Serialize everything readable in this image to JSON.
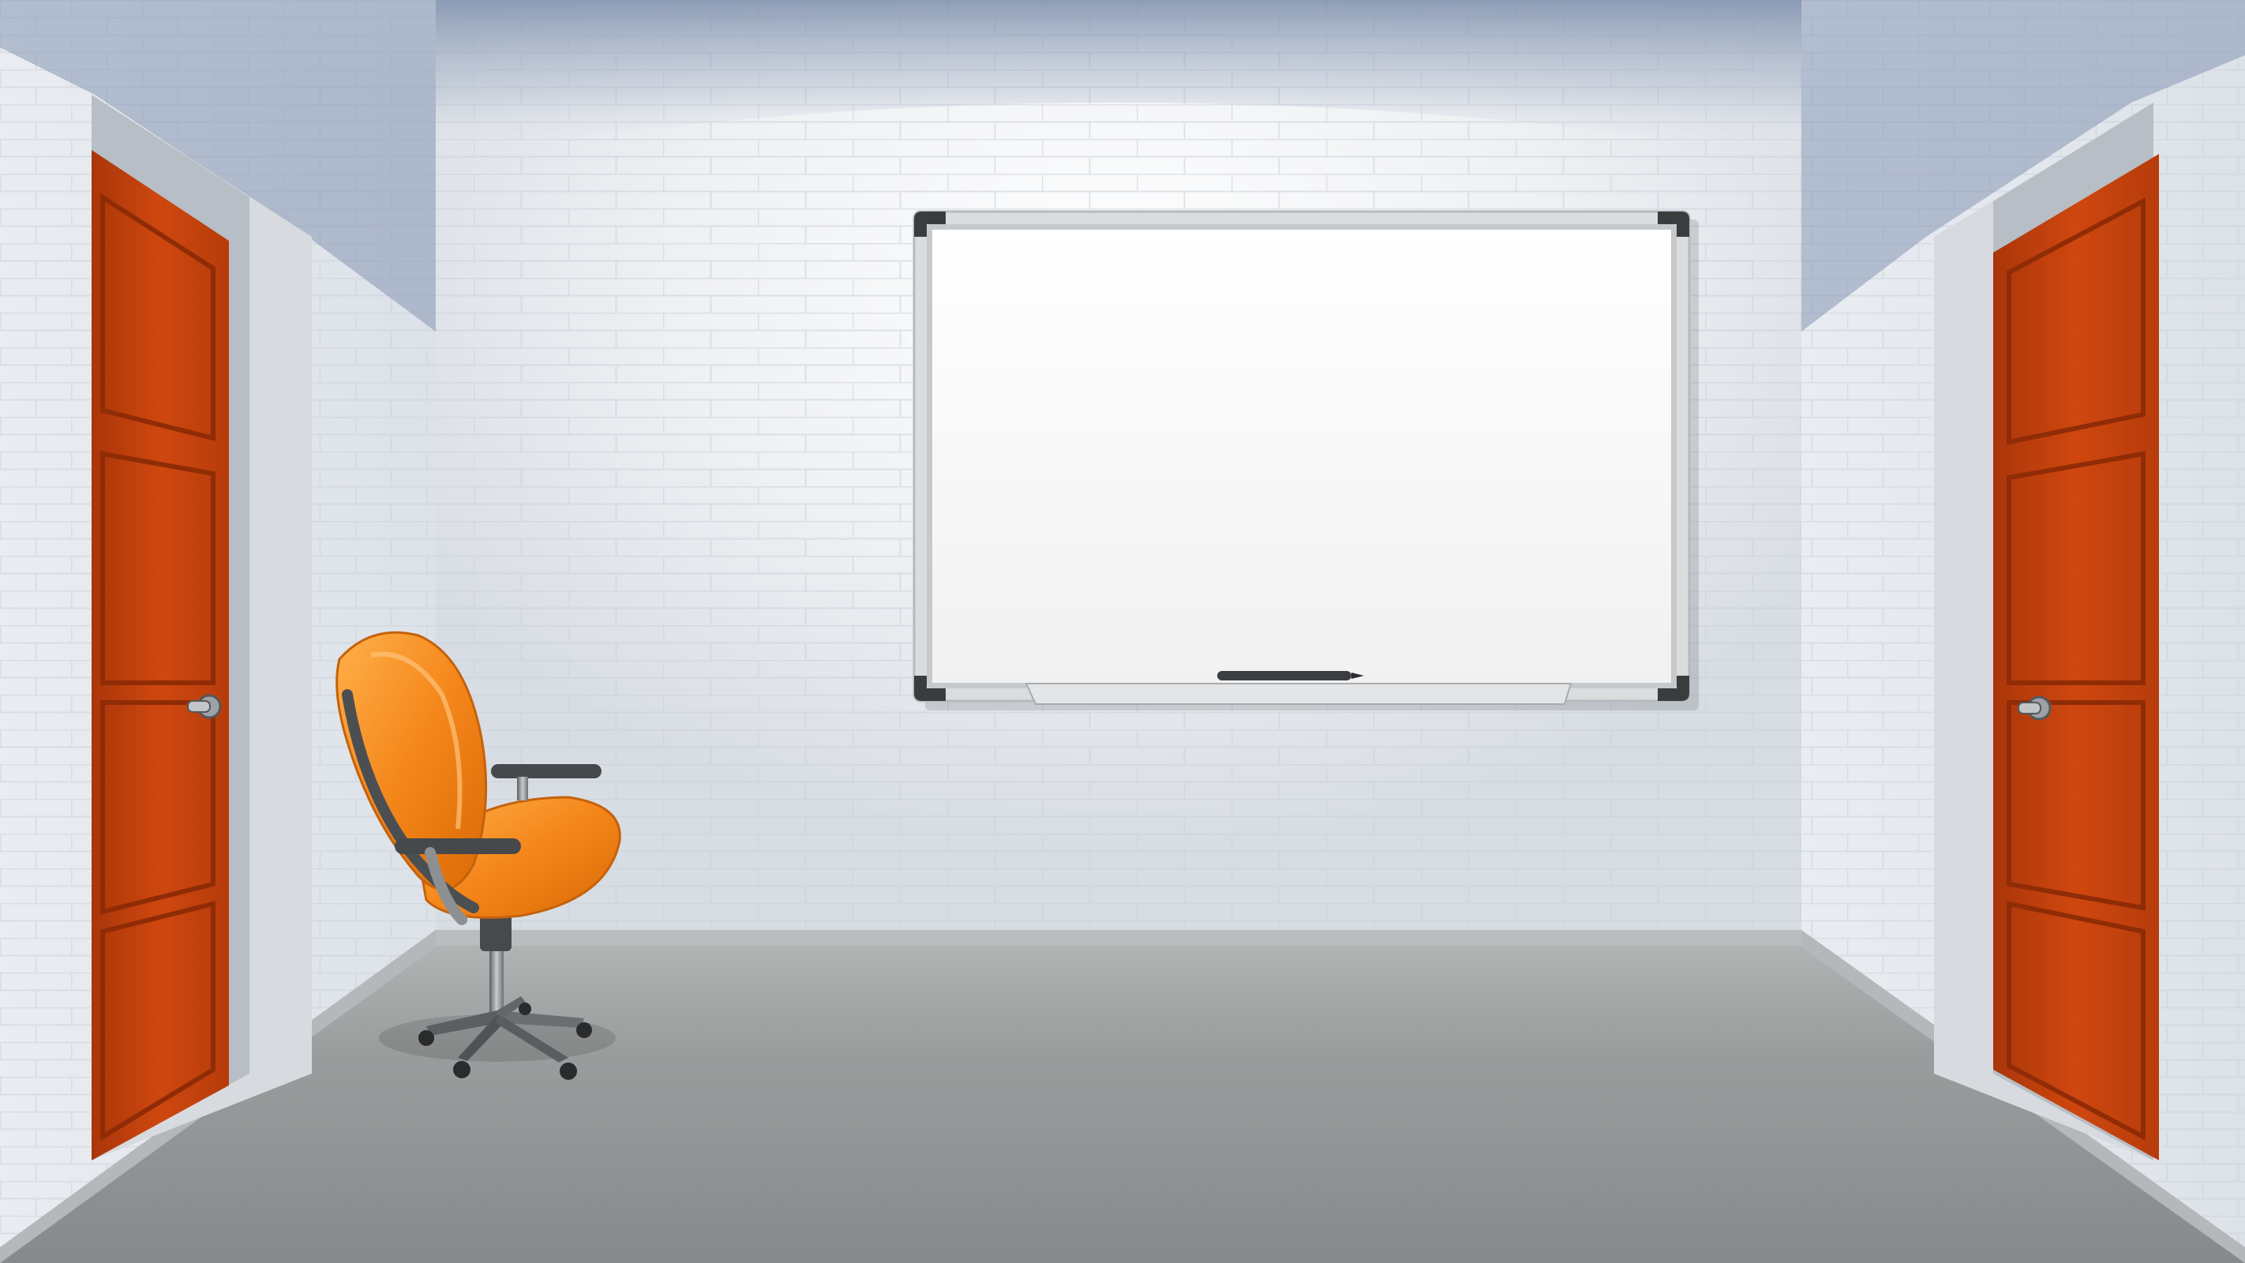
{
  "scene": {
    "type": "escape-room",
    "view": "room-interior"
  },
  "colors": {
    "wall": "#e6eaef",
    "wall_shadow": "#8b9bb4",
    "floor": "#8e9091",
    "door": "#c8420d",
    "door_dark": "#8f2c06",
    "chair": "#f08a1e",
    "whiteboard_frame": "#d9dbdd",
    "whiteboard_corner": "#3a3c3e"
  },
  "objects": {
    "left_door": {
      "icon": "door-icon"
    },
    "right_door": {
      "icon": "door-icon"
    },
    "whiteboard": {
      "icon": "whiteboard-icon",
      "text": ""
    },
    "marker": {
      "icon": "marker-icon"
    },
    "chair": {
      "icon": "office-chair-icon"
    }
  }
}
